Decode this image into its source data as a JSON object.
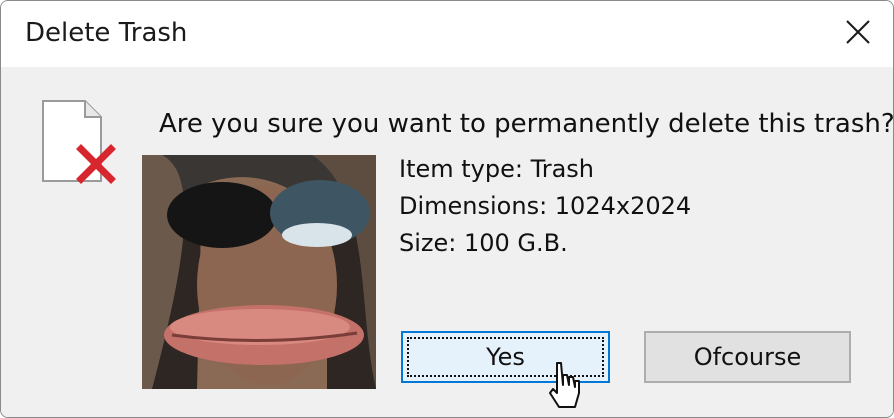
{
  "window": {
    "title": "Delete Trash"
  },
  "dialog": {
    "question": "Are you sure you want to permanently delete this trash?",
    "properties": [
      "Item type: Trash",
      "Dimensions: 1024x2024",
      "Size: 100 G.B."
    ]
  },
  "buttons": {
    "yes": "Yes",
    "ofcourse": "Ofcourse"
  },
  "icons": {
    "close": "close-icon",
    "file": "file-delete-icon",
    "cursor": "mouse-cursor-icon"
  },
  "colors": {
    "accent": "#0078d7",
    "delete_x": "#d7262e",
    "dialog_bg": "#f0f0f0"
  }
}
